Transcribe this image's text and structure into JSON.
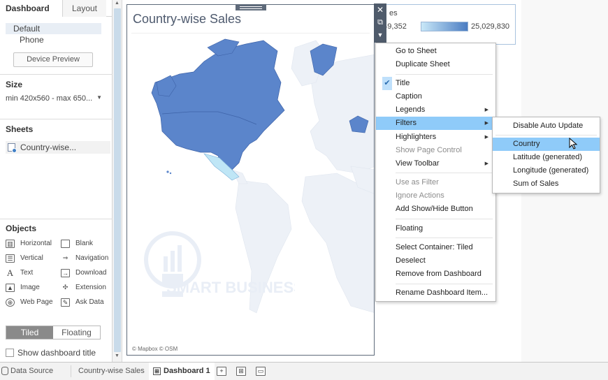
{
  "left_panel": {
    "tabs": {
      "dashboard": "Dashboard",
      "layout": "Layout",
      "collapse_glyph": "‹"
    },
    "devices": [
      "Default",
      "Phone"
    ],
    "device_preview_label": "Device Preview",
    "size": {
      "title": "Size",
      "value": "min 420x560 - max 650..."
    },
    "sheets": {
      "title": "Sheets",
      "items": [
        "Country-wise..."
      ]
    },
    "objects": {
      "title": "Objects",
      "items": [
        {
          "label": "Horizontal",
          "icon": "horizontal-icon"
        },
        {
          "label": "Blank",
          "icon": "blank-icon"
        },
        {
          "label": "Vertical",
          "icon": "vertical-icon"
        },
        {
          "label": "Navigation",
          "icon": "navigation-icon"
        },
        {
          "label": "Text",
          "icon": "text-icon"
        },
        {
          "label": "Download",
          "icon": "download-icon"
        },
        {
          "label": "Image",
          "icon": "image-icon"
        },
        {
          "label": "Extension",
          "icon": "extension-icon"
        },
        {
          "label": "Web Page",
          "icon": "web-page-icon"
        },
        {
          "label": "Ask Data",
          "icon": "ask-data-icon"
        }
      ]
    },
    "layout_mode": {
      "tiled": "Tiled",
      "floating": "Floating",
      "selected": "Tiled"
    },
    "show_dashboard_title": "Show dashboard title"
  },
  "map": {
    "title": "Country-wise Sales",
    "credit": "© Mapbox © OSM",
    "watermark": "SMART BUSINESS"
  },
  "legend": {
    "title": "es",
    "min": ",949,352",
    "max": "25,029,830",
    "gradient_from": "#c9e8f8",
    "gradient_to": "#4a7cc2"
  },
  "context_menu": {
    "items": [
      {
        "label": "Go to Sheet",
        "state": "normal"
      },
      {
        "label": "Duplicate Sheet",
        "state": "normal"
      },
      {
        "label": "Title",
        "state": "checked"
      },
      {
        "label": "Caption",
        "state": "normal"
      },
      {
        "label": "Legends",
        "state": "submenu"
      },
      {
        "label": "Filters",
        "state": "highlighted-submenu"
      },
      {
        "label": "Highlighters",
        "state": "submenu"
      },
      {
        "label": "Show Page Control",
        "state": "disabled"
      },
      {
        "label": "View Toolbar",
        "state": "submenu"
      },
      {
        "label": "Use as Filter",
        "state": "disabled"
      },
      {
        "label": "Ignore Actions",
        "state": "disabled"
      },
      {
        "label": "Add Show/Hide Button",
        "state": "normal"
      },
      {
        "label": "Floating",
        "state": "normal"
      },
      {
        "label": "Select Container: Tiled",
        "state": "normal"
      },
      {
        "label": "Deselect",
        "state": "normal"
      },
      {
        "label": "Remove from Dashboard",
        "state": "normal"
      },
      {
        "label": "Rename Dashboard Item...",
        "state": "normal"
      }
    ]
  },
  "filters_submenu": {
    "items": [
      "Disable Auto Update",
      "Country",
      "Latitude (generated)",
      "Longitude (generated)",
      "Sum of Sales"
    ],
    "highlighted": "Country"
  },
  "bottom_tabs": {
    "data_source": "Data Source",
    "sheet": "Country-wise Sales",
    "dashboard": "Dashboard 1"
  },
  "colors": {
    "accent_highlight": "#8fcbf9",
    "map_fill": "#5b85cb",
    "map_fill_light": "#bfe6f6",
    "map_land": "#edf1f7"
  }
}
